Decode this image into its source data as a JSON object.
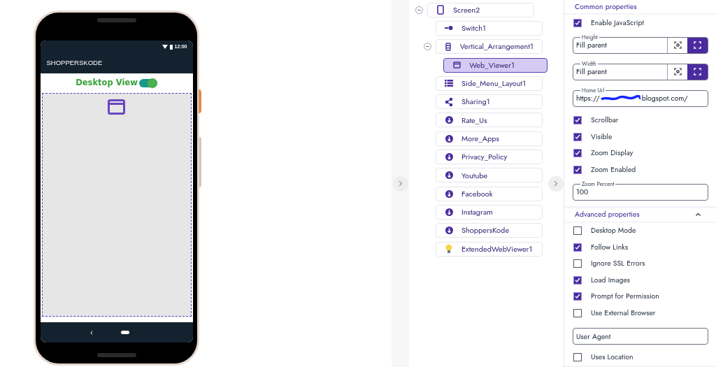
{
  "phone": {
    "status_time": "12:00",
    "app_title": "SHOPPERSKODE",
    "switch_label": "Desktop View",
    "switch_on": true
  },
  "tree": [
    {
      "name": "Screen2",
      "kind": "phone",
      "selected": false,
      "expanded": true,
      "children": [
        {
          "name": "Switch1",
          "kind": "switch",
          "selected": false
        },
        {
          "name": "Vertical_Arrangement1",
          "kind": "arrangement",
          "selected": false,
          "expanded": true,
          "children": [
            {
              "name": "Web_Viewer1",
              "kind": "webviewer",
              "selected": true
            }
          ]
        },
        {
          "name": "Side_Menu_Layout1",
          "kind": "menu",
          "selected": false
        },
        {
          "name": "Sharing1",
          "kind": "share",
          "selected": false
        },
        {
          "name": "Rate_Us",
          "kind": "extension",
          "selected": false
        },
        {
          "name": "More_Apps",
          "kind": "extension",
          "selected": false
        },
        {
          "name": "Privacy_Policy",
          "kind": "extension",
          "selected": false
        },
        {
          "name": "Youtube",
          "kind": "extension",
          "selected": false
        },
        {
          "name": "Facebook",
          "kind": "extension",
          "selected": false
        },
        {
          "name": "Instagram",
          "kind": "extension",
          "selected": false
        },
        {
          "name": "ShoppersKode",
          "kind": "extension",
          "selected": false
        },
        {
          "name": "ExtendedWebViewer1",
          "kind": "bulb",
          "selected": false
        }
      ]
    }
  ],
  "properties": [
    {
      "title": "Common properties",
      "items": [
        {
          "kind": "checkbox",
          "label": "Enable JavaScript",
          "checked": true
        },
        {
          "kind": "size",
          "label": "Height",
          "value": "Fill parent",
          "fill_selected": true
        },
        {
          "kind": "size",
          "label": "Width",
          "value": "Fill parent",
          "fill_selected": true
        },
        {
          "kind": "url",
          "label": "Home Url",
          "value_start": "https://",
          "value_end": "blogspot.com/"
        },
        {
          "kind": "checkbox",
          "label": "Scrollbar",
          "checked": true
        },
        {
          "kind": "checkbox",
          "label": "Visible",
          "checked": true
        },
        {
          "kind": "checkbox",
          "label": "Zoom Display",
          "checked": true
        },
        {
          "kind": "checkbox",
          "label": "Zoom Enabled",
          "checked": true
        },
        {
          "kind": "field",
          "label": "Zoom Percent",
          "value": "100"
        }
      ]
    },
    {
      "title": "Advanced properties",
      "expanded": true,
      "items": [
        {
          "kind": "checkbox",
          "label": "Desktop Mode",
          "checked": false
        },
        {
          "kind": "checkbox",
          "label": "Follow Links",
          "checked": true
        },
        {
          "kind": "checkbox",
          "label": "Ignore SSL Errors",
          "checked": false
        },
        {
          "kind": "checkbox",
          "label": "Load Images",
          "checked": true
        },
        {
          "kind": "checkbox",
          "label": "Prompt for Permission",
          "checked": true
        },
        {
          "kind": "checkbox",
          "label": "Use External Browser",
          "checked": false
        },
        {
          "kind": "textbox",
          "placeholder": "User Agent"
        },
        {
          "kind": "checkbox",
          "label": "Uses Location",
          "checked": false
        }
      ]
    }
  ]
}
